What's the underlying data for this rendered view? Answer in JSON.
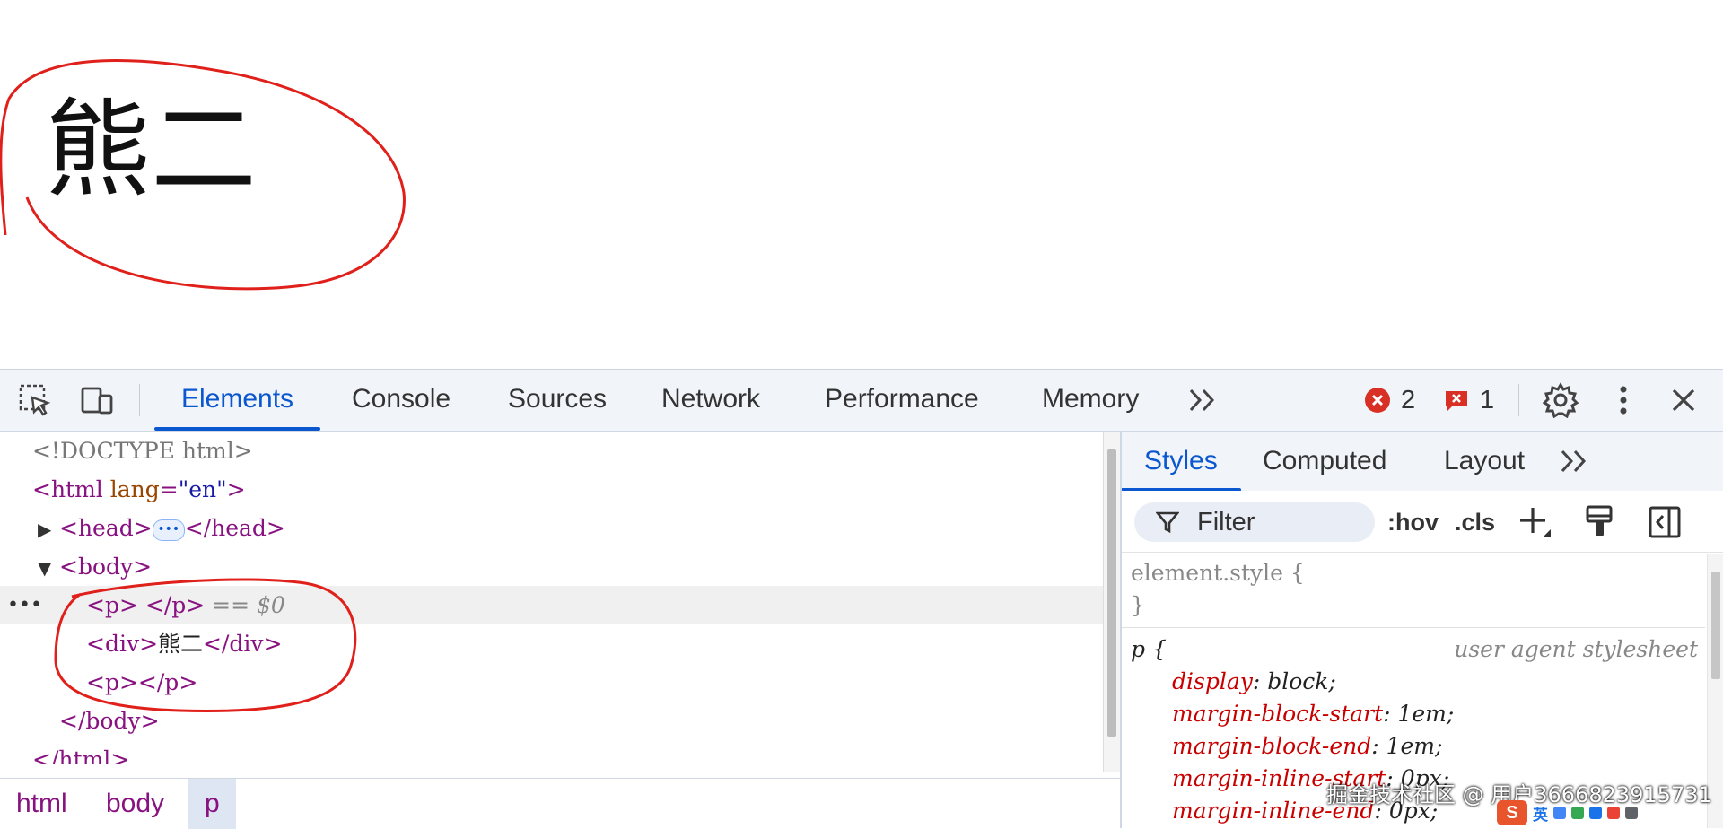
{
  "page": {
    "heading_text": "熊二"
  },
  "devtools": {
    "tabs": [
      "Elements",
      "Console",
      "Sources",
      "Network",
      "Performance",
      "Memory"
    ],
    "active_tab": "Elements",
    "status": {
      "errors": "2",
      "issues": "1"
    },
    "icons": [
      "inspect-element-icon",
      "device-toolbar-icon",
      "more-tabs-icon",
      "error-icon",
      "issue-icon",
      "settings-gear-icon",
      "more-vert-icon",
      "close-icon"
    ],
    "elements": {
      "doctype": "<!DOCTYPE html>",
      "html_open_tag": "html",
      "html_attr_name": "lang",
      "html_attr_value": "\"en\"",
      "head_tag": "head",
      "body_tag": "body",
      "selected_line_tag": "p",
      "selected_ref": "== $0",
      "div_tag": "div",
      "div_text": "熊二",
      "p_tag": "p"
    },
    "breadcrumb": [
      "html",
      "body",
      "p"
    ],
    "styles": {
      "subtabs": [
        "Styles",
        "Computed",
        "Layout"
      ],
      "active_subtab": "Styles",
      "filter_label": "Filter",
      "hov_label": ":hov",
      "cls_label": ".cls",
      "element_style_selector": "element.style {",
      "close_brace": "}",
      "p_selector": "p {",
      "ua_label": "user agent stylesheet",
      "declarations": [
        {
          "prop": "display",
          "value": "block;"
        },
        {
          "prop": "margin-block-start",
          "value": "1em;"
        },
        {
          "prop": "margin-block-end",
          "value": "1em;"
        },
        {
          "prop": "margin-inline-start",
          "value": "0px;"
        },
        {
          "prop": "margin-inline-end",
          "value": "0px;"
        }
      ]
    }
  },
  "overlay": {
    "watermark": "掘金技术社区 @ 用户3666823915731",
    "ime_label": "英"
  },
  "colors": {
    "accent": "#0b57d0",
    "tag": "#881280",
    "attr": "#994500",
    "attr_value": "#1a1aa6",
    "css_prop": "#c80000",
    "annotation_red": "#e0201a"
  }
}
